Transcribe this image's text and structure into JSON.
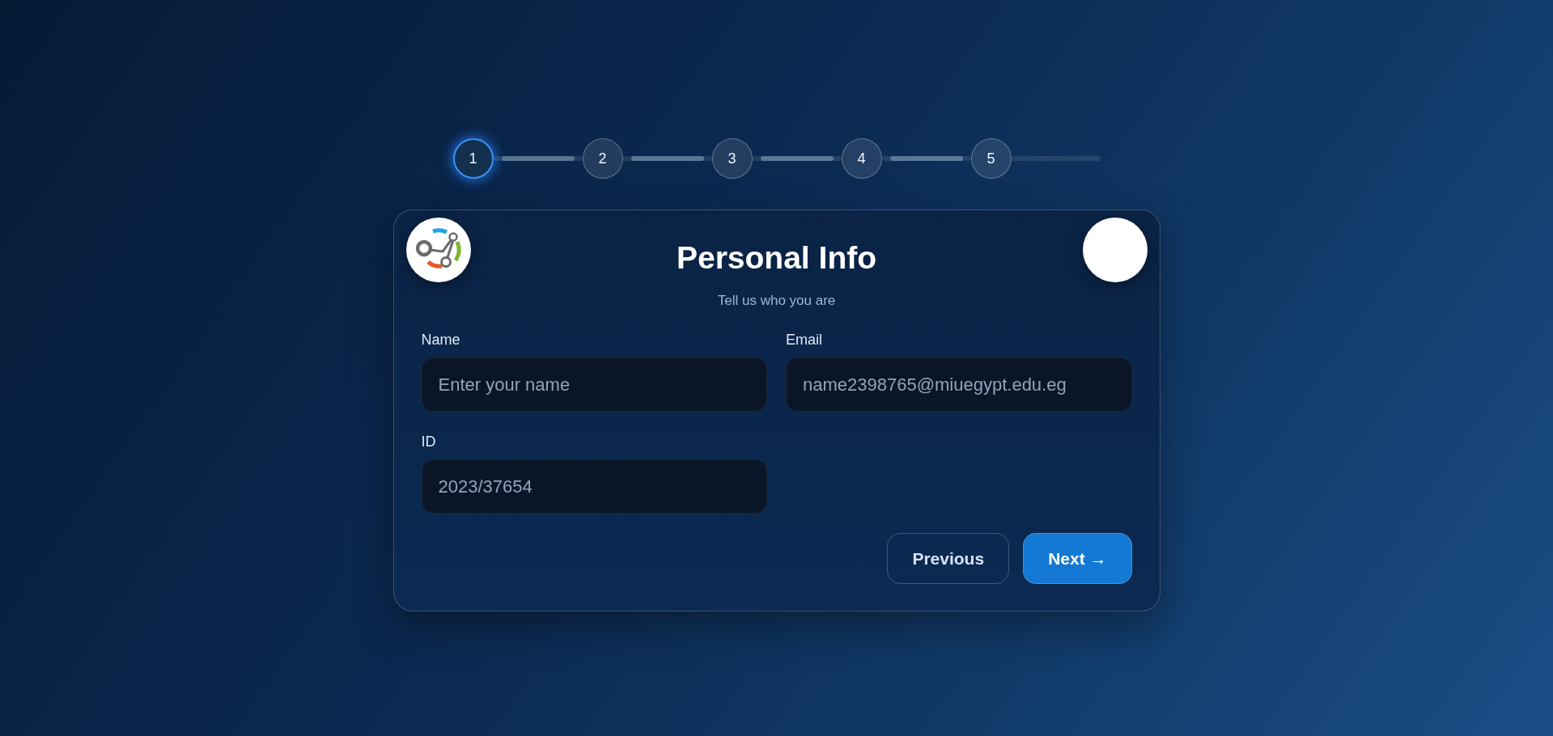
{
  "stepper": {
    "steps": [
      {
        "label": "1",
        "selected": true
      },
      {
        "label": "2",
        "selected": false
      },
      {
        "label": "3",
        "selected": false
      },
      {
        "label": "4",
        "selected": false
      },
      {
        "label": "5",
        "selected": false
      }
    ]
  },
  "card": {
    "title": "Personal Info",
    "subtitle": "Tell us who you are",
    "fields": [
      {
        "label": "Name",
        "placeholder": "Enter your name"
      },
      {
        "label": "Email",
        "placeholder": "name2398765@miuegypt.edu.eg"
      },
      {
        "label": "ID",
        "placeholder": "2023/37654"
      }
    ],
    "buttons": [
      {
        "label": "Previous",
        "kind": "secondary"
      },
      {
        "label": "Next →",
        "kind": "primary"
      }
    ]
  }
}
